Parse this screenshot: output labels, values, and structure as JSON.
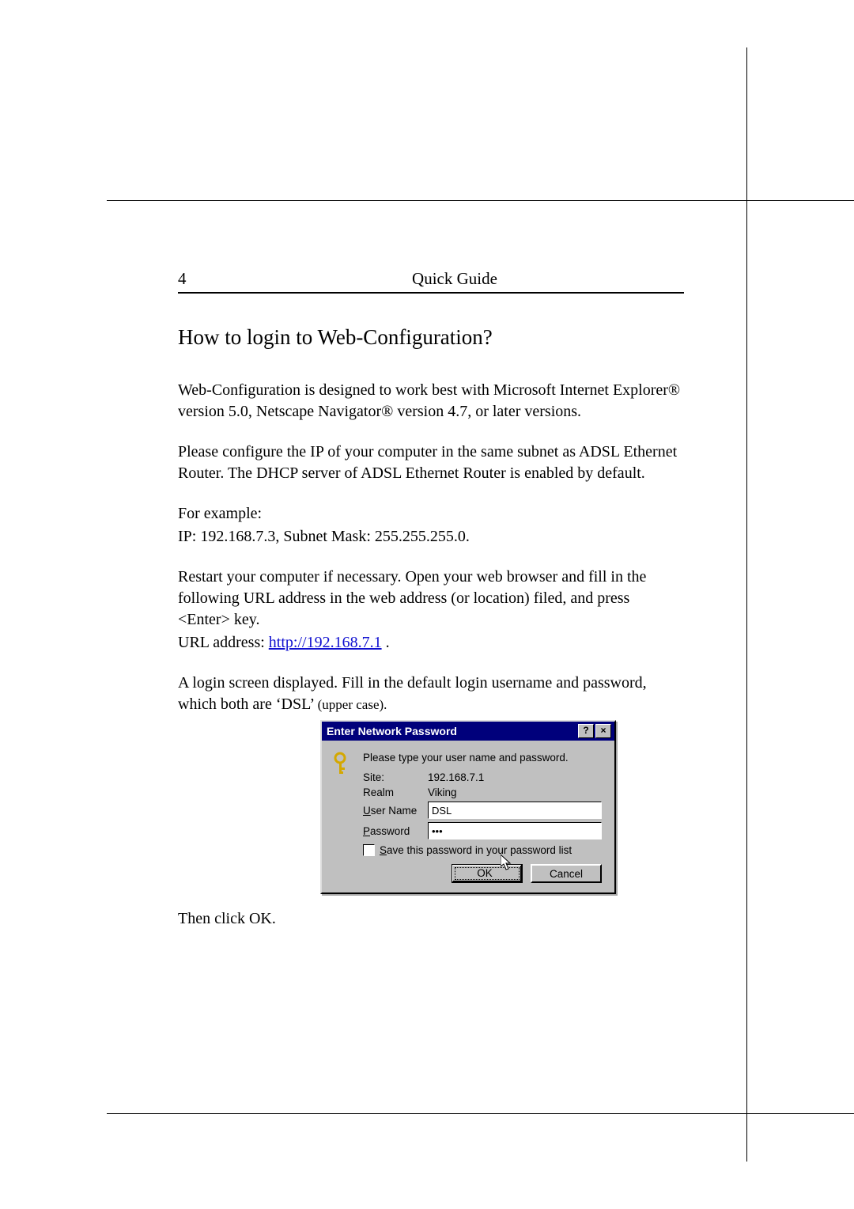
{
  "header": {
    "page_number": "4",
    "running_title": "Quick Guide"
  },
  "section_title": "How to login to Web-Configuration?",
  "paragraphs": {
    "p1": "Web-Configuration is designed to work best with Microsoft Internet Explorer® version 5.0, Netscape Navigator® version 4.7, or later versions.",
    "p2": "Please configure the IP of your computer in the same subnet as ADSL Ethernet Router. The DHCP server of ADSL Ethernet Router is enabled by default.",
    "p3_lead": "For example:",
    "p3_indent": "IP: 192.168.7.3, Subnet Mask: 255.255.255.0.",
    "p4": "Restart your computer if necessary.   Open your web browser and fill in the following URL address in the web address (or location) filed, and press <Enter> key.",
    "p4_url_label": "URL address: ",
    "p4_url": "http://192.168.7.1",
    "p4_url_tail": " .",
    "p5a": "A login screen displayed. Fill in the default login username and password, which both are ‘DSL’ ",
    "p5b": "(upper case).",
    "p6": "Then click OK."
  },
  "dialog": {
    "title": "Enter Network Password",
    "help_glyph": "?",
    "close_glyph": "×",
    "message": "Please type your user name and password.",
    "rows": {
      "site_label": "Site:",
      "site_value": "192.168.7.1",
      "realm_label": "Realm",
      "realm_value": "Viking",
      "user_label_u": "U",
      "user_label_rest": "ser Name",
      "user_value": "DSL",
      "pass_label_p": "P",
      "pass_label_rest": "assword",
      "pass_value": "•••"
    },
    "checkbox": {
      "s": "S",
      "rest": "ave this password in your password list"
    },
    "buttons": {
      "ok": "OK",
      "cancel": "Cancel"
    }
  }
}
